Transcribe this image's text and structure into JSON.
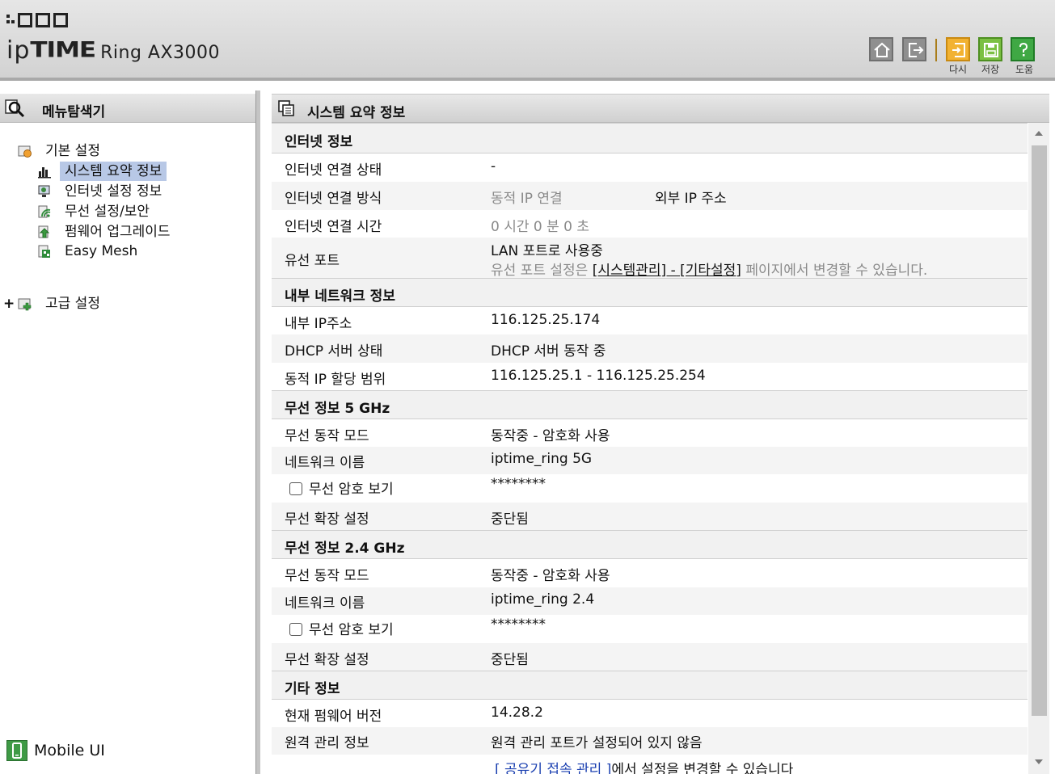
{
  "header": {
    "brand_ip": "ip",
    "brand_time": "TIME",
    "model": "Ring AX3000",
    "buttons": {
      "refresh_label": "다시",
      "save_label": "저장",
      "help_label": "도움"
    }
  },
  "left_panel": {
    "title": "메뉴탐색기",
    "basic_settings": "기본 설정",
    "items": [
      {
        "label": "시스템 요약 정보",
        "icon": "bar-chart-icon",
        "selected": true
      },
      {
        "label": "인터넷 설정 정보",
        "icon": "monitor-globe-icon"
      },
      {
        "label": "무선 설정/보안",
        "icon": "wireless-icon"
      },
      {
        "label": "펌웨어 업그레이드",
        "icon": "firmware-upgrade-icon"
      },
      {
        "label": "Easy Mesh",
        "icon": "mesh-icon"
      }
    ],
    "expand_symbol": "+",
    "advanced_settings": "고급 설정",
    "mobile_ui": "Mobile UI"
  },
  "main": {
    "title": "시스템 요약 정보",
    "internet": {
      "header": "인터넷 정보",
      "status_key": "인터넷 연결 상태",
      "status_val": "-",
      "method_key": "인터넷 연결 방식",
      "method_val": "동적 IP 연결",
      "external_ip_label": "외부 IP 주소",
      "time_key": "인터넷 연결 시간",
      "time_val": "0 시간 0 분 0 초",
      "wired_key": "유선 포트",
      "wired_val": "LAN 포트로 사용중",
      "wired_hint_pre": "유선 포트 설정은 ",
      "wired_hint_link": "[시스템관리] - [기타설정]",
      "wired_hint_post": " 페이지에서 변경할 수 있습니다."
    },
    "lan": {
      "header": "내부 네트워크 정보",
      "ip_key": "내부 IP주소",
      "ip_val": "116.125.25.174",
      "dhcp_key": "DHCP 서버 상태",
      "dhcp_val": "DHCP 서버 동작 중",
      "range_key": "동적 IP 할당 범위",
      "range_val": "116.125.25.1 -  116.125.25.254"
    },
    "wifi5": {
      "header": "무선 정보 5 GHz",
      "mode_key": "무선 동작 모드",
      "mode_val": "동작중 - 암호화 사용",
      "ssid_key": "네트워크 이름",
      "ssid_val": "iptime_ring 5G",
      "pw_key": "무선 암호 보기",
      "pw_val": "********",
      "ext_key": "무선 확장 설정",
      "ext_val": "중단됨"
    },
    "wifi24": {
      "header": "무선 정보 2.4 GHz",
      "mode_key": "무선 동작 모드",
      "mode_val": "동작중 - 암호화 사용",
      "ssid_key": "네트워크 이름",
      "ssid_val": "iptime_ring 2.4",
      "pw_key": "무선 암호 보기",
      "pw_val": "********",
      "ext_key": "무선 확장 설정",
      "ext_val": "중단됨"
    },
    "etc": {
      "header": "기타 정보",
      "fw_key": "현재 펌웨어 버전",
      "fw_val": "14.28.2",
      "remote_key": "원격 관리 정보",
      "remote_val": "원격 관리 포트가 설정되어 있지 않음",
      "remote_hint_link": "[ 공유기 접속 관리 ]",
      "remote_hint_post": "에서 설정을 변경할 수 있습니다"
    }
  }
}
